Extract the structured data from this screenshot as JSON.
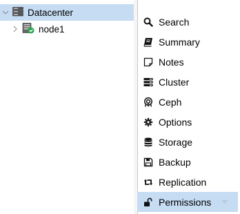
{
  "tree": {
    "datacenter_label": "Datacenter",
    "node_label": "node1"
  },
  "menu": {
    "items": [
      {
        "label": "Search",
        "icon": "search-icon"
      },
      {
        "label": "Summary",
        "icon": "book-icon"
      },
      {
        "label": "Notes",
        "icon": "note-icon"
      },
      {
        "label": "Cluster",
        "icon": "server-stack-icon"
      },
      {
        "label": "Ceph",
        "icon": "ceph-icon"
      },
      {
        "label": "Options",
        "icon": "gear-icon"
      },
      {
        "label": "Storage",
        "icon": "database-icon"
      },
      {
        "label": "Backup",
        "icon": "floppy-icon"
      },
      {
        "label": "Replication",
        "icon": "retweet-icon"
      },
      {
        "label": "Permissions",
        "icon": "unlock-icon"
      }
    ],
    "active_index": 9
  },
  "colors": {
    "selection": "#c5dcf3",
    "node_status_ok": "#21a64b"
  }
}
